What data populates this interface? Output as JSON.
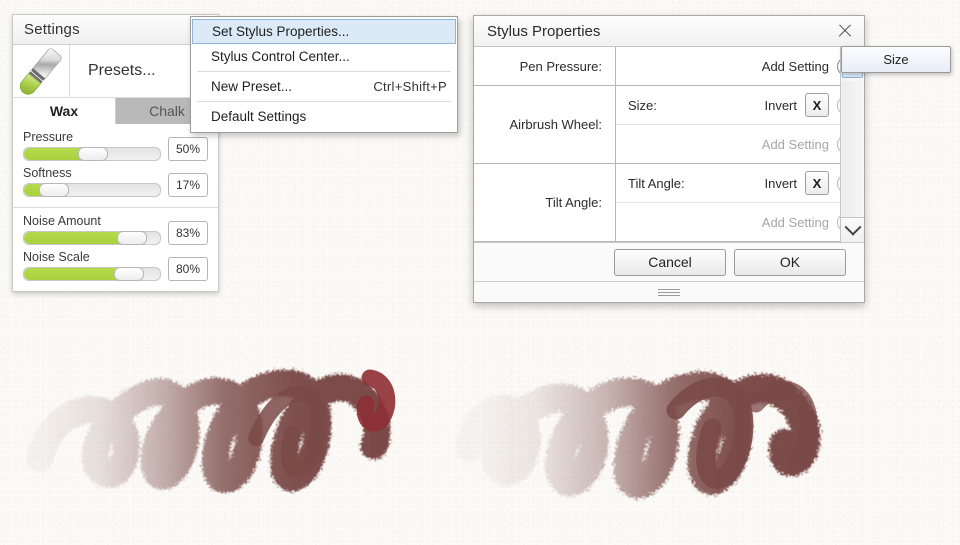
{
  "app": {
    "canvas_bg": "#fbfaf6",
    "stroke_color": "#7a4a48",
    "accent_green": "#b0d643",
    "highlight_blue": "#dceaf7"
  },
  "settings_panel": {
    "title": "Settings",
    "menu_icon": "list-icon",
    "preset_label": "Presets...",
    "preset_thumb_icon": "crayon-icon",
    "tabs": [
      {
        "label": "Wax",
        "active": true
      },
      {
        "label": "Chalk",
        "active": false
      }
    ],
    "slider_groups": [
      {
        "sliders": [
          {
            "name": "Pressure",
            "value": "50%",
            "fill_pct": 50,
            "knob_pct": 50
          },
          {
            "name": "Softness",
            "value": "17%",
            "fill_pct": 17,
            "knob_pct": 17
          }
        ]
      },
      {
        "sliders": [
          {
            "name": "Noise Amount",
            "value": "83%",
            "fill_pct": 83,
            "knob_pct": 83
          },
          {
            "name": "Noise Scale",
            "value": "80%",
            "fill_pct": 80,
            "knob_pct": 80
          }
        ]
      }
    ]
  },
  "context_menu": {
    "items": [
      {
        "label": "Set Stylus Properties...",
        "accel": "",
        "highlighted": true,
        "separator_after": false
      },
      {
        "label": "Stylus Control Center...",
        "accel": "",
        "highlighted": false,
        "separator_after": true
      },
      {
        "label": "New Preset...",
        "accel": "Ctrl+Shift+P",
        "highlighted": false,
        "separator_after": true
      },
      {
        "label": "Default Settings",
        "accel": "",
        "highlighted": false,
        "separator_after": false
      }
    ]
  },
  "stylus_dialog": {
    "title": "Stylus Properties",
    "close_icon": "close-icon",
    "rows": [
      {
        "label": "Pen Pressure:",
        "sub_rows": [
          {
            "kind": "add",
            "name": "",
            "add_label": "Add Setting",
            "invert_label": "",
            "muted": false
          }
        ]
      },
      {
        "label": "Airbrush Wheel:",
        "sub_rows": [
          {
            "kind": "mapping",
            "name": "Size:",
            "invert_label": "Invert",
            "invert_value": "X",
            "add_label": "",
            "muted": false
          },
          {
            "kind": "add",
            "name": "",
            "add_label": "Add Setting",
            "invert_label": "",
            "muted": true
          }
        ]
      },
      {
        "label": "Tilt Angle:",
        "sub_rows": [
          {
            "kind": "mapping",
            "name": "Tilt Angle:",
            "invert_label": "Invert",
            "invert_value": "X",
            "add_label": "",
            "muted": false
          },
          {
            "kind": "add",
            "name": "",
            "add_label": "Add Setting",
            "invert_label": "",
            "muted": true
          }
        ]
      }
    ],
    "scroll_down_icon": "chevron-down-icon",
    "buttons": {
      "cancel": "Cancel",
      "ok": "OK"
    },
    "resize_grip_icon": "resize-grip-icon"
  },
  "size_popup": {
    "label": "Size"
  }
}
